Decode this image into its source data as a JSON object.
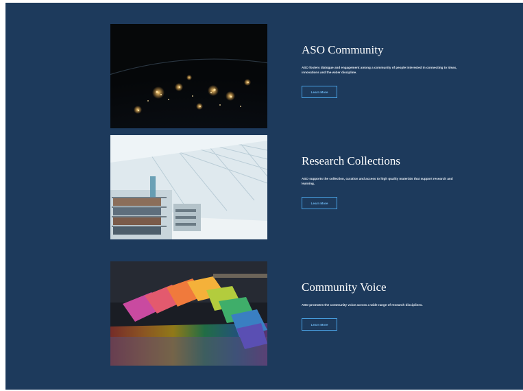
{
  "cards": [
    {
      "title": "ASO Community",
      "description": "ASO fosters dialogue and engagement among a community of people interested in connecting to ideas, innovations and the wider discipline.",
      "button_label": "Learn More",
      "image_icon": "earth-at-night-image"
    },
    {
      "title": "Research Collections",
      "description": "ASO supports the collection, curation and access to high quality materials that support research and learning.",
      "button_label": "Learn More",
      "image_icon": "library-image"
    },
    {
      "title": "Community Voice",
      "description": "ASO promotes the community voice across a wide range of research disciplines.",
      "button_label": "Learn More",
      "image_icon": "rainbow-chalk-image"
    }
  ],
  "colors": {
    "background": "#1d3a5c",
    "heading": "#ffffff",
    "button_border": "#4aa3e6"
  }
}
